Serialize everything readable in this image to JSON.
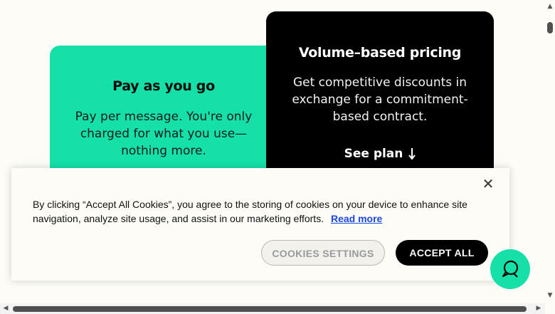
{
  "pricing": {
    "pay_as_you_go": {
      "title": "Pay as you go",
      "body": "Pay per message. You're only charged for what you use—nothing more."
    },
    "volume": {
      "title": "Volume–based pricing",
      "body": "Get competitive discounts in exchange for a commitment-based contract.",
      "cta": "See plan",
      "cta_icon": "arrow-down-icon"
    },
    "colors": {
      "green": "#14e0a8",
      "black": "#000000"
    }
  },
  "cookie_banner": {
    "text": "By clicking “Accept All Cookies”, you agree to the storing of cookies on your device to enhance site navigation, analyze site usage, and assist in our marketing efforts.",
    "read_more": "Read more",
    "settings_label": "COOKIES SETTINGS",
    "accept_label": "ACCEPT ALL",
    "close_icon": "close-icon",
    "link_color": "#1a48e0"
  },
  "chat": {
    "icon": "chat-bubbles-icon"
  },
  "scrollbars": {
    "up": "▲",
    "down": "▼",
    "left": "◀",
    "right": "▶"
  }
}
